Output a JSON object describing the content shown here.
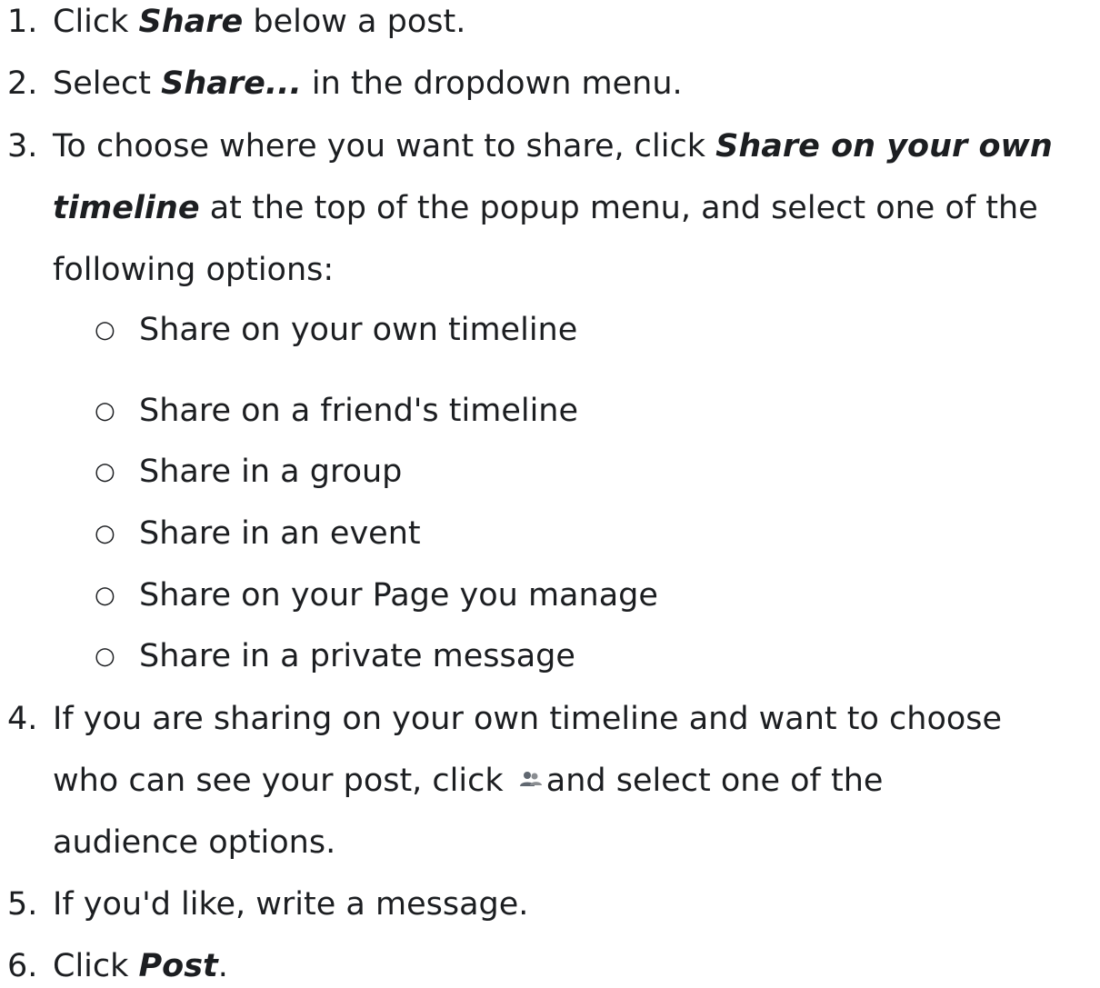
{
  "steps": [
    {
      "num": "1.",
      "lines": [
        {
          "pre": "Click ",
          "bold": "Share",
          "post": " below a post."
        }
      ]
    },
    {
      "num": "2.",
      "lines": [
        {
          "pre": "Select ",
          "bold": "Share...",
          "post": " in the dropdown menu."
        }
      ]
    },
    {
      "num": "3.",
      "lines": [
        {
          "pre": "To choose where you want to share, click ",
          "bold": "Share on your own",
          "post": ""
        },
        {
          "pre": "",
          "bold": "timeline",
          "post": " at the top of the popup menu, and select one of the"
        },
        {
          "pre": "following options:",
          "bold": "",
          "post": ""
        }
      ],
      "options": [
        "Share on your own timeline",
        "Share on a friend's timeline",
        "Share in a group",
        "Share in an event",
        "Share on your Page you manage",
        "Share in a private message"
      ]
    },
    {
      "num": "4.",
      "lines": [
        {
          "pre": "If you are sharing on your own timeline and want to choose",
          "bold": "",
          "post": ""
        },
        {
          "pre": "who can see your post, click ",
          "icon": "audience-icon",
          "post": "and select one of the"
        },
        {
          "pre": "audience options.",
          "bold": "",
          "post": ""
        }
      ]
    },
    {
      "num": "5.",
      "lines": [
        {
          "pre": "If you'd like, write a message.",
          "bold": "",
          "post": ""
        }
      ]
    },
    {
      "num": "6.",
      "lines": [
        {
          "pre": "Click ",
          "bold": "Post",
          "post": "."
        }
      ]
    }
  ],
  "bullet_glyph": "○",
  "colors": {
    "text": "#1c1e21",
    "icon": "#606770"
  }
}
